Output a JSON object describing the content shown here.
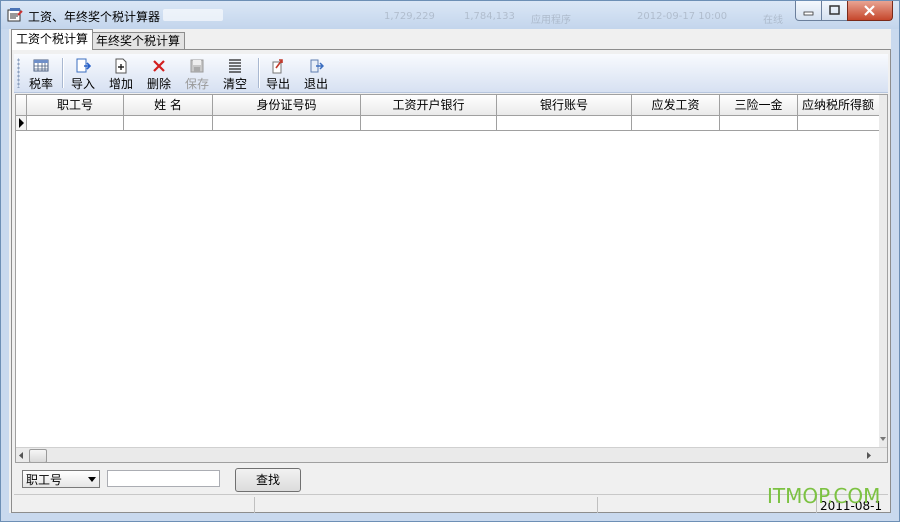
{
  "window": {
    "title": "工资、年终奖个税计算器",
    "blurred_title_items": [
      "1,729,229",
      "1,784,133",
      "应用程序",
      "2012-09-17 10:00",
      "在线"
    ]
  },
  "tabs": [
    {
      "label": "工资个税计算",
      "active": true
    },
    {
      "label": "年终奖个税计算",
      "active": false
    }
  ],
  "toolbar": {
    "buttons": [
      {
        "label": "税率",
        "icon": "table-icon",
        "enabled": true
      },
      {
        "label": "导入",
        "icon": "import-icon",
        "enabled": true
      },
      {
        "label": "增加",
        "icon": "add-document-icon",
        "enabled": true
      },
      {
        "label": "删除",
        "icon": "delete-icon",
        "enabled": true
      },
      {
        "label": "保存",
        "icon": "save-icon",
        "enabled": false
      },
      {
        "label": "清空",
        "icon": "clear-list-icon",
        "enabled": true
      },
      {
        "label": "导出",
        "icon": "export-icon",
        "enabled": true
      },
      {
        "label": "退出",
        "icon": "exit-icon",
        "enabled": true
      }
    ]
  },
  "grid": {
    "columns": [
      "职工号",
      "姓  名",
      "身份证号码",
      "工资开户银行",
      "银行账号",
      "应发工资",
      "三险一金",
      "应纳税所得额"
    ],
    "rows": [
      [
        "",
        "",
        "",
        "",
        "",
        "",
        "",
        ""
      ]
    ]
  },
  "search": {
    "field_selected": "职工号",
    "input_value": "",
    "button_label": "查找"
  },
  "status": {
    "date": "2011-08-1"
  },
  "watermark": "ITMOP.COM",
  "colors": {
    "titlebar": "#c3d5ec",
    "toolbar": "#d7e1f2",
    "delete_red": "#d21f1f",
    "watermark_green": "#7cc242"
  }
}
